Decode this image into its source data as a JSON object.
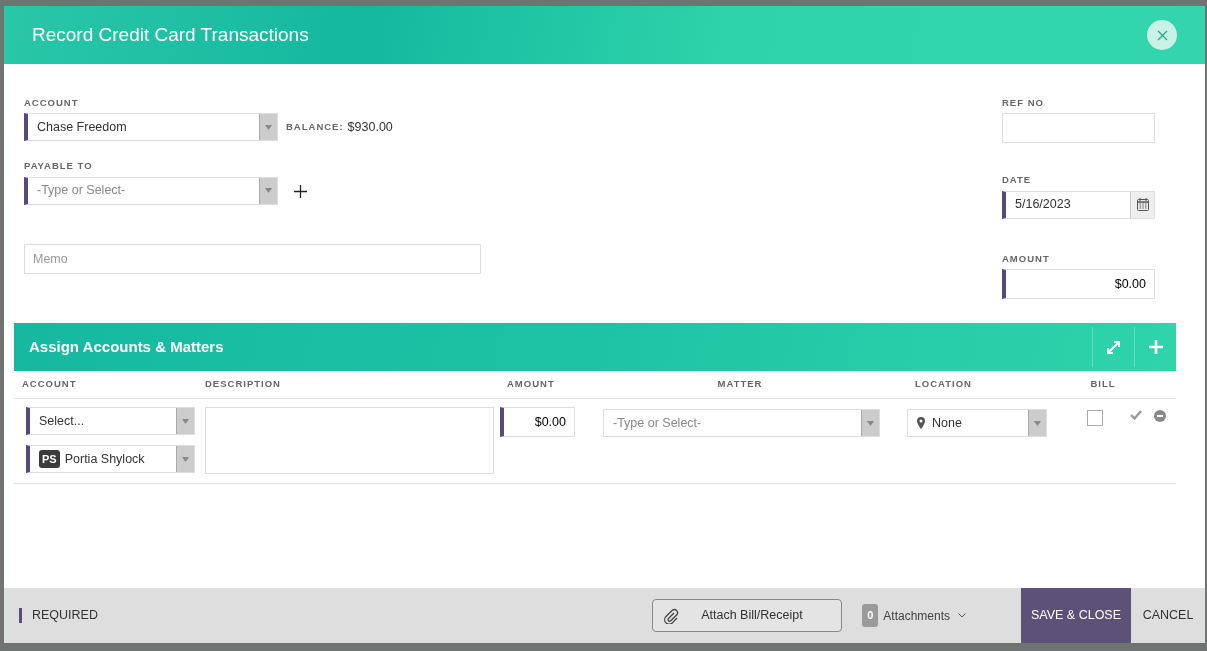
{
  "dialog": {
    "title": "Record Credit Card Transactions"
  },
  "form": {
    "account": {
      "label": "ACCOUNT",
      "value": "Chase Freedom",
      "required": true
    },
    "balance": {
      "label": "BALANCE:",
      "value": "$930.00"
    },
    "payable_to": {
      "label": "PAYABLE TO",
      "placeholder": "-Type or Select-",
      "required": true
    },
    "memo": {
      "placeholder": "Memo",
      "required": false
    },
    "ref_no": {
      "label": "REF NO",
      "required": false
    },
    "date": {
      "label": "DATE",
      "value": "5/16/2023",
      "required": true
    },
    "amount": {
      "label": "AMOUNT",
      "value": "$0.00",
      "required": true
    }
  },
  "assign": {
    "title": "Assign Accounts & Matters",
    "columns": [
      "ACCOUNT",
      "DESCRIPTION",
      "AMOUNT",
      "MATTER",
      "LOCATION",
      "BILL"
    ],
    "rows": [
      {
        "account": {
          "value": "Select...",
          "required": true
        },
        "timekeeper": {
          "initials": "PS",
          "value": "Portia Shylock",
          "required": true
        },
        "amount": {
          "value": "$0.00",
          "required": true
        },
        "matter": {
          "placeholder": "-Type or Select-",
          "required": false
        },
        "location": {
          "value": "None",
          "required": false
        },
        "bill": false
      }
    ]
  },
  "footer": {
    "required_legend": "REQUIRED",
    "attach_button": "Attach Bill/Receipt",
    "attachments_count": "0",
    "attachments_label": "Attachments",
    "save_button": "SAVE & CLOSE",
    "cancel_button": "CANCEL"
  }
}
